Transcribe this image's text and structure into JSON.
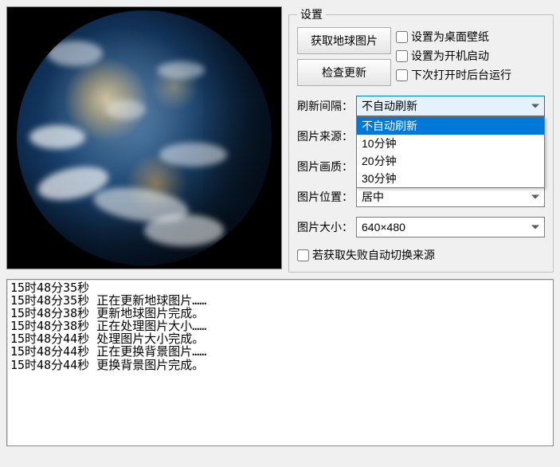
{
  "settings": {
    "legend": "设置",
    "btn_get_earth": "获取地球图片",
    "btn_check_update": "检查更新",
    "chk_wallpaper": "设置为桌面壁纸",
    "chk_autostart": "设置为开机启动",
    "chk_background_next": "下次打开时后台运行",
    "refresh_label": "刷新间隔：",
    "refresh_selected": "不自动刷新",
    "refresh_options": [
      "不自动刷新",
      "10分钟",
      "20分钟",
      "30分钟"
    ],
    "source_label": "图片来源：",
    "quality_label": "图片画质：",
    "position_label": "图片位置：",
    "position_value": "居中",
    "size_label": "图片大小：",
    "size_value": "640×480",
    "auto_switch": "若获取失败自动切换来源"
  },
  "log_lines": [
    "15时48分35秒",
    "15时48分35秒 正在更新地球图片……",
    "15时48分38秒 更新地球图片完成。",
    "15时48分38秒 正在处理图片大小……",
    "15时48分44秒 处理图片大小完成。",
    "15时48分44秒 正在更换背景图片……",
    "15时48分44秒 更换背景图片完成。"
  ]
}
